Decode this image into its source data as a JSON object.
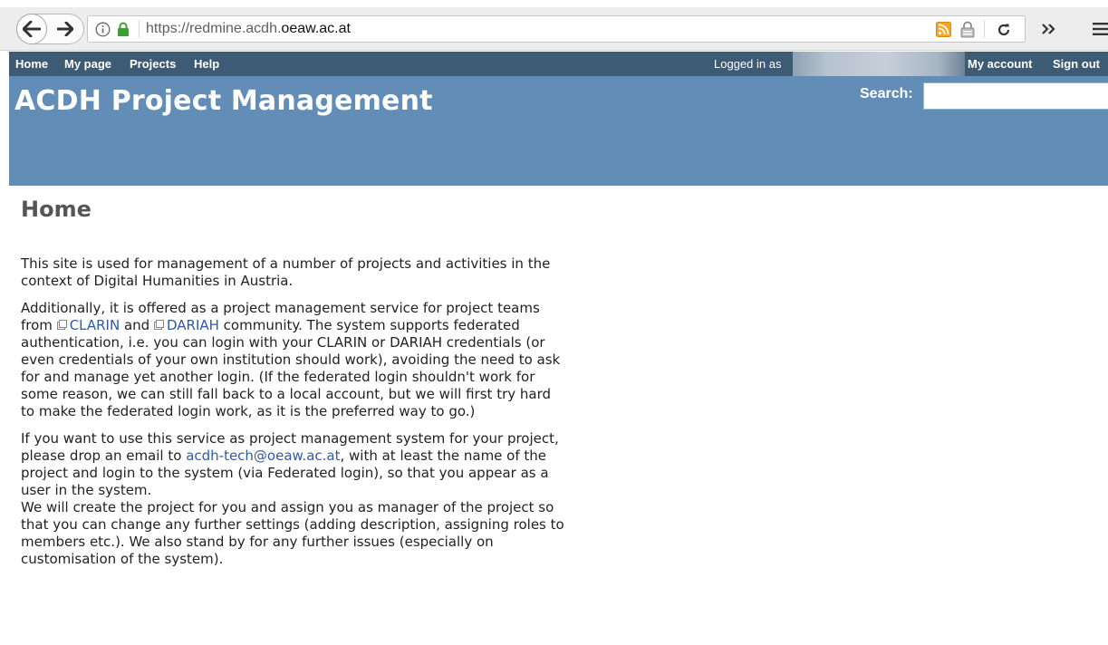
{
  "browser": {
    "url_scheme": "https://redmine.acdh.",
    "url_host": "oeaw.ac.at",
    "overflow_label": "»"
  },
  "top_menu": {
    "items": [
      "Home",
      "My page",
      "Projects",
      "Help"
    ],
    "logged_in_label": "Logged in as",
    "account_label": "My account",
    "signout_label": "Sign out"
  },
  "header": {
    "title": "ACDH Project Management",
    "search_label": "Search:",
    "search_value": ""
  },
  "page": {
    "title": "Home",
    "p1": "This site is used for management of a number of projects and activities in the context of Digital Humanities in Austria.",
    "p2_a": "Additionally, it is offered as a project management service for project teams from ",
    "link_clarin": "CLARIN",
    "p2_and": " and ",
    "link_dariah": "DARIAH",
    "p2_b": " community. The system supports federated authentication, i.e. you can login with your CLARIN or DARIAH credentials (or even credentials of your own institution should work), avoiding the need to ask for and manage yet another login. (If the federated login shouldn't work for some reason, we can still fall back to a local account, but we will first try hard to make the federated login work, as it is the preferred way to go.)",
    "p3_a": "If you want to use this service as project management system for your project, please drop an email to ",
    "link_email": "acdh-tech@oeaw.ac.at",
    "p3_b": ", with at least the name of the project and login to the system (via Federated login), so that you appear as a user in the system.",
    "p3_c": "We will create the project for you and assign you as manager of the project so that you can change any further settings (adding description, assigning roles to members etc.). We also stand by for any further issues (especially on customisation of the system)."
  },
  "colors": {
    "top_menu_bg": "#3e5b76",
    "header_bg": "#628db6",
    "link": "#2f5aa6",
    "title_grey": "#555555"
  }
}
